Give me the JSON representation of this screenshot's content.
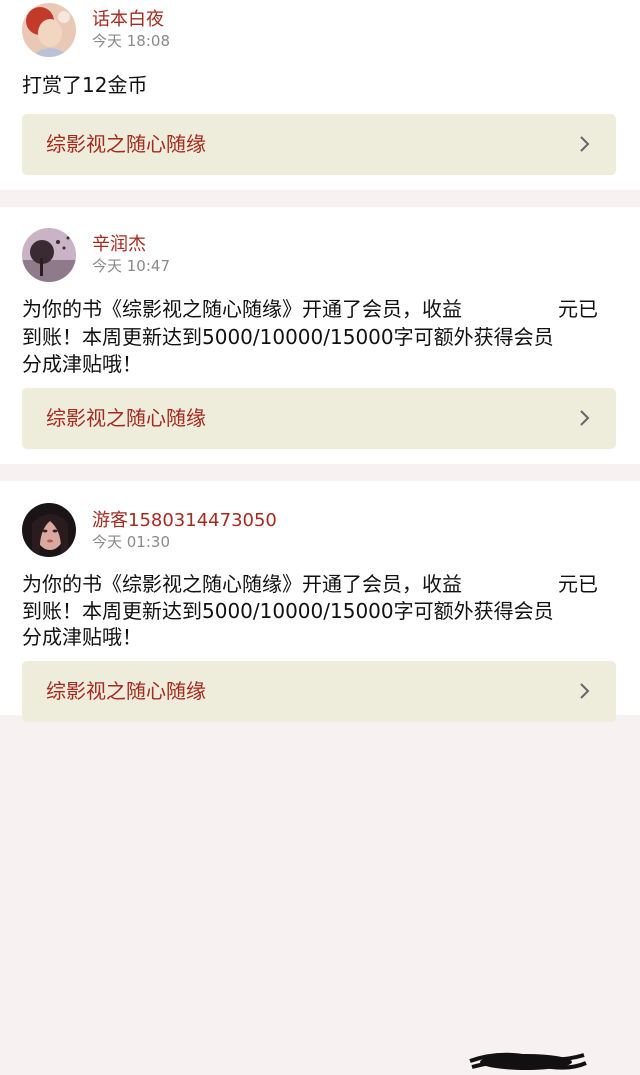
{
  "entries": [
    {
      "user": "话本白夜",
      "time": "今天 18:08",
      "message_lines": [
        "打赏了12金币"
      ],
      "book": "综影视之随心随缘",
      "avatar_icon": "girl-avatar-icon"
    },
    {
      "user": "辛润杰",
      "time": "今天 10:47",
      "message_lines": [
        "为你的书《综影视之随心随缘》开通了会员，收益",
        "到账！本周更新达到5000/10000/15000字可额外获得会员",
        "分成津贴哦！"
      ],
      "message_tail": "元已",
      "book": "综影视之随心随缘",
      "avatar_icon": "tree-avatar-icon"
    },
    {
      "user": "游客1580314473050",
      "time": "今天 01:30",
      "message_lines": [
        "为你的书《综影视之随心随缘》开通了会员，收益",
        "到账！本周更新达到5000/10000/15000字可额外获得会员",
        "分成津贴哦！"
      ],
      "message_tail": "元已",
      "book": "综影视之随心随缘",
      "avatar_icon": "woman-avatar-icon"
    }
  ],
  "colors": {
    "accent": "#a52a1f",
    "link_bg": "#eeecdb",
    "page_bg": "#f7f1f2",
    "time": "#8a8a8a"
  }
}
